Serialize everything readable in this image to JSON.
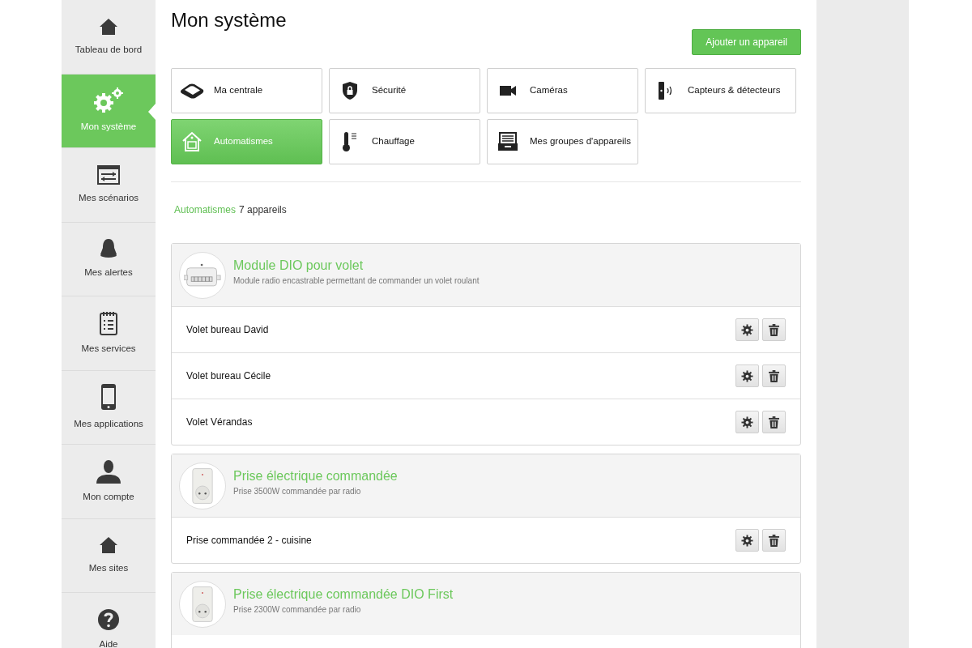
{
  "sidebar": {
    "items": [
      {
        "label": "Tableau de bord",
        "kind": "house",
        "selected": false
      },
      {
        "label": "Mon système",
        "kind": "gears",
        "selected": true
      },
      {
        "label": "Mes scénarios",
        "kind": "sliders",
        "selected": false
      },
      {
        "label": "Mes alertes",
        "kind": "bell",
        "selected": false
      },
      {
        "label": "Mes services",
        "kind": "clipboard",
        "selected": false
      },
      {
        "label": "Mes applications",
        "kind": "phone",
        "selected": false
      },
      {
        "label": "Mon compte",
        "kind": "person",
        "selected": false
      },
      {
        "label": "Mes sites",
        "kind": "house",
        "selected": false
      },
      {
        "label": "Aide",
        "kind": "help",
        "selected": false
      }
    ]
  },
  "page": {
    "title": "Mon système",
    "add_button": "Ajouter un appareil"
  },
  "categories": [
    {
      "label": "Ma centrale",
      "kind": "hub",
      "selected": false
    },
    {
      "label": "Sécurité",
      "kind": "shield",
      "selected": false
    },
    {
      "label": "Caméras",
      "kind": "camera",
      "selected": false
    },
    {
      "label": "Capteurs & détecteurs",
      "kind": "sensor",
      "selected": false
    },
    {
      "label": "Automatismes",
      "kind": "home",
      "selected": true
    },
    {
      "label": "Chauffage",
      "kind": "thermometer",
      "selected": false
    },
    {
      "label": "Mes groupes d'appareils",
      "kind": "drawer",
      "selected": false
    }
  ],
  "summary": {
    "category": "Automatismes",
    "count": "7 appareils"
  },
  "device_groups": [
    {
      "name": "Module DIO pour volet",
      "description": "Module radio encastrable permettant de commander un volet roulant",
      "kind": "module",
      "devices": [
        {
          "name": "Volet bureau David"
        },
        {
          "name": "Volet bureau Cécile"
        },
        {
          "name": "Volet Vérandas"
        }
      ]
    },
    {
      "name": "Prise électrique commandée",
      "description": "Prise 3500W commandée par radio",
      "kind": "plug",
      "devices": [
        {
          "name": "Prise commandée 2 - cuisine"
        }
      ]
    },
    {
      "name": "Prise électrique commandée DIO First",
      "description": "Prise 2300W commandée par radio",
      "kind": "plug"
    }
  ]
}
